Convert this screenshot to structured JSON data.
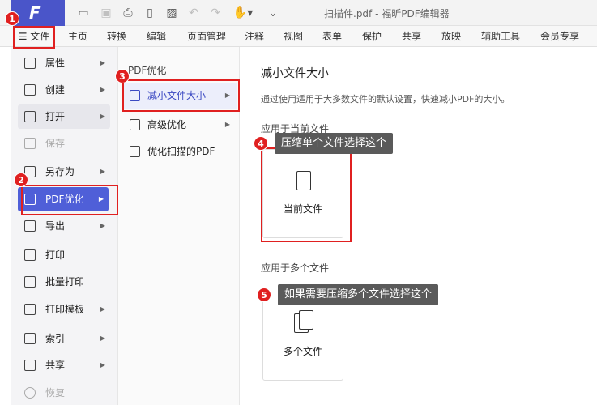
{
  "titlebar": {
    "logo": "F",
    "doc_title": "扫描件.pdf - 福昕PDF编辑器"
  },
  "menubar": {
    "file_label": "☰ 文件",
    "items": [
      "主页",
      "转换",
      "编辑",
      "页面管理",
      "注释",
      "视图",
      "表单",
      "保护",
      "共享",
      "放映",
      "辅助工具",
      "会员专享"
    ]
  },
  "left_menu": {
    "items": [
      {
        "label": "属性",
        "has_arrow": true
      },
      {
        "label": "创建",
        "has_arrow": true
      },
      {
        "label": "打开",
        "has_arrow": true
      },
      {
        "label": "保存",
        "has_arrow": false
      },
      {
        "label": "另存为",
        "has_arrow": true
      },
      {
        "label": "PDF优化",
        "has_arrow": true
      },
      {
        "label": "导出",
        "has_arrow": true
      },
      {
        "label": "打印",
        "has_arrow": false
      },
      {
        "label": "批量打印",
        "has_arrow": false
      },
      {
        "label": "打印模板",
        "has_arrow": true
      },
      {
        "label": "索引",
        "has_arrow": true
      },
      {
        "label": "共享",
        "has_arrow": true
      },
      {
        "label": "恢复",
        "has_arrow": false
      }
    ]
  },
  "mid_menu": {
    "heading": "PDF优化",
    "items": [
      {
        "label": "减小文件大小"
      },
      {
        "label": "高级优化"
      },
      {
        "label": "优化扫描的PDF"
      }
    ]
  },
  "content": {
    "title": "减小文件大小",
    "description": "通过使用适用于大多数文件的默认设置，快速减小PDF的大小。",
    "section_current": "应用于当前文件",
    "card_current": "当前文件",
    "section_multi": "应用于多个文件",
    "card_multi": "多个文件"
  },
  "annotations": {
    "badges": [
      "1",
      "2",
      "3",
      "4",
      "5"
    ],
    "tip_single": "压缩单个文件选择这个",
    "tip_multi": "如果需要压缩多个文件选择这个"
  },
  "colors": {
    "accent": "#4f5fd8",
    "annotation_red": "#e02020",
    "tooltip_bg": "#5a5a5a"
  }
}
